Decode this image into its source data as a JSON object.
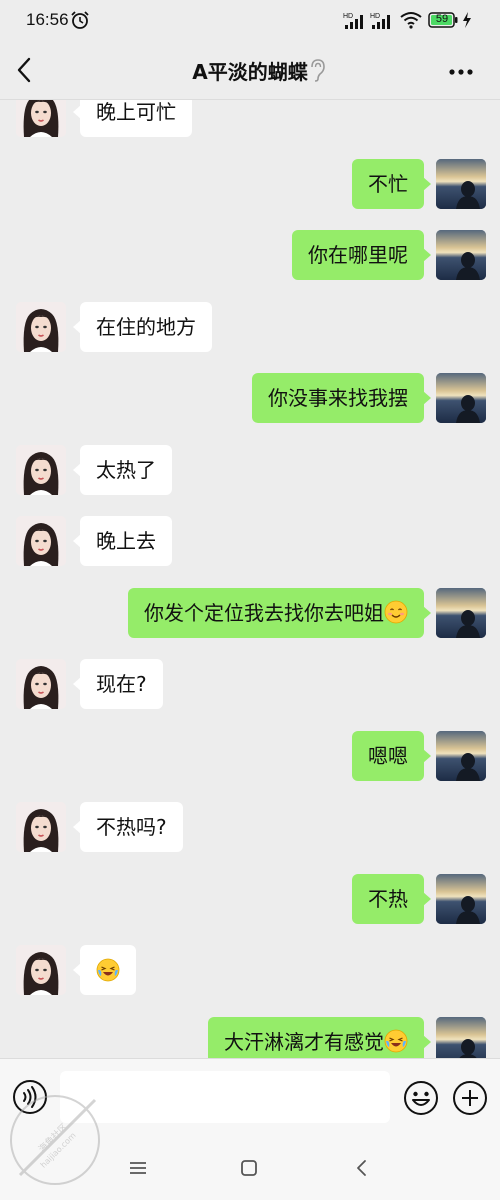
{
  "status_bar": {
    "time": "16:56",
    "battery": "59",
    "network_labels": [
      "HD",
      "HD"
    ]
  },
  "header": {
    "title": "A平淡的蝴蝶"
  },
  "messages": [
    {
      "side": "left",
      "text": "晚上可忙"
    },
    {
      "side": "right",
      "text": "不忙"
    },
    {
      "side": "right",
      "text": "你在哪里呢"
    },
    {
      "side": "left",
      "text": "在住的地方"
    },
    {
      "side": "right",
      "text": "你没事来找我摆"
    },
    {
      "side": "left",
      "text": "太热了"
    },
    {
      "side": "left",
      "text": "晚上去"
    },
    {
      "side": "right",
      "text": "你发个定位我去找你去吧姐",
      "emoji": "smile-emoji"
    },
    {
      "side": "left",
      "text": "现在?"
    },
    {
      "side": "right",
      "text": "嗯嗯"
    },
    {
      "side": "left",
      "text": "不热吗?"
    },
    {
      "side": "right",
      "text": "不热"
    },
    {
      "side": "left",
      "text": "",
      "emoji": "laugh-cry-emoji"
    },
    {
      "side": "right",
      "text": "大汗淋漓才有感觉",
      "emoji": "laugh-cry-emoji"
    }
  ],
  "input": {
    "value": "",
    "placeholder": ""
  },
  "watermark": {
    "text": "海角社区",
    "url": "haijiao.com"
  },
  "colors": {
    "background": "#ededed",
    "bubble_sent": "#95ec69",
    "bubble_received": "#ffffff",
    "battery_fill": "#4cd964"
  }
}
